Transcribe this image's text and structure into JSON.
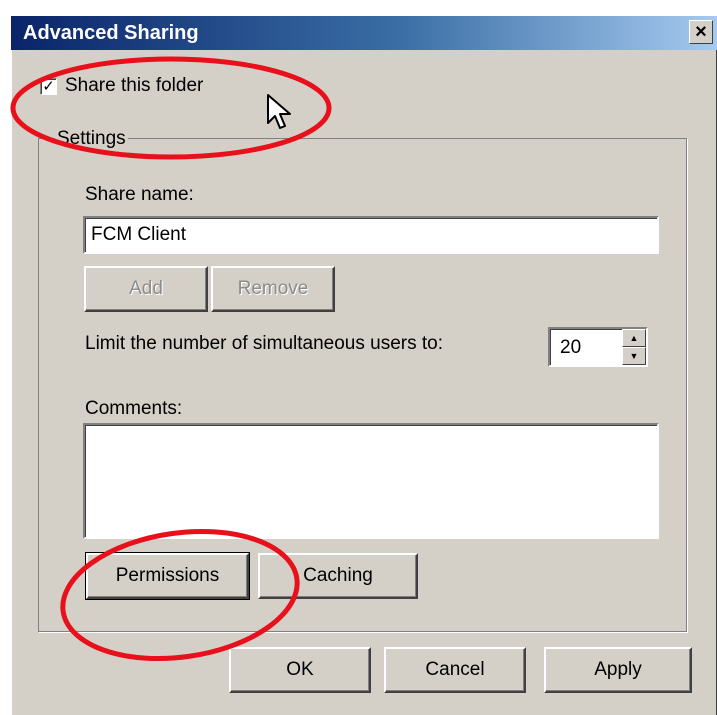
{
  "window": {
    "title": "Advanced Sharing",
    "close_glyph": "×"
  },
  "share": {
    "label": "Share this folder",
    "checked": true,
    "check_glyph": "✓"
  },
  "settings": {
    "group_label": "Settings",
    "share_name_label": "Share name:",
    "share_name_value": "FCM Client",
    "add_label": "Add",
    "remove_label": "Remove",
    "limit_label": "Limit the number of simultaneous users to:",
    "limit_value": "20",
    "comments_label": "Comments:",
    "comments_value": "",
    "permissions_label": "Permissions",
    "caching_label": "Caching"
  },
  "footer": {
    "ok_label": "OK",
    "cancel_label": "Cancel",
    "apply_label": "Apply"
  },
  "annotations": {
    "color": "#e8101a"
  }
}
